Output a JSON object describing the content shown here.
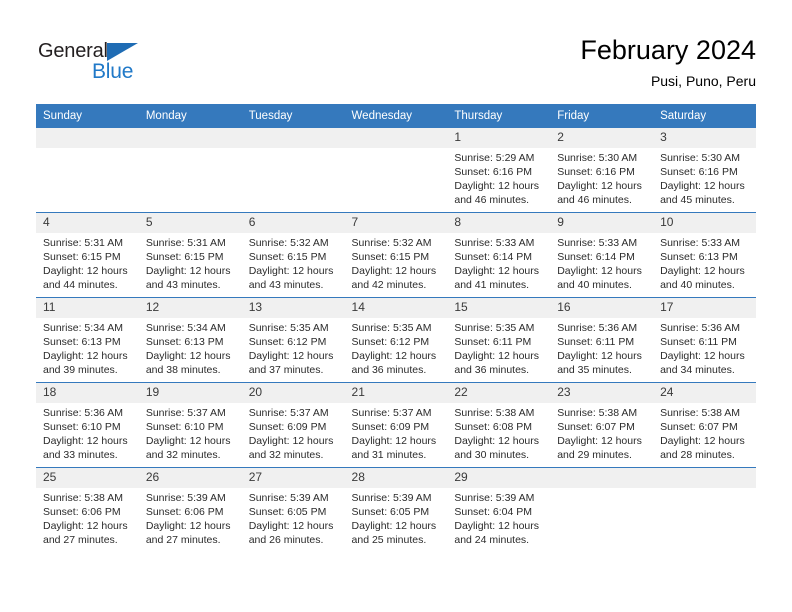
{
  "brand": {
    "name_dark": "General",
    "name_blue": "Blue",
    "accent_blue": "#2079c8",
    "triangle_blue": "#1f6cb4"
  },
  "header": {
    "title": "February 2024",
    "subtitle": "Pusi, Puno, Peru"
  },
  "calendar": {
    "header_bg": "#3579bd",
    "daynum_bg": "#f0f0f0",
    "weekdays": [
      "Sunday",
      "Monday",
      "Tuesday",
      "Wednesday",
      "Thursday",
      "Friday",
      "Saturday"
    ],
    "weeks": [
      [
        {
          "day": "",
          "sunrise": "",
          "sunset": "",
          "daylight": "",
          "blank": true
        },
        {
          "day": "",
          "sunrise": "",
          "sunset": "",
          "daylight": "",
          "blank": true
        },
        {
          "day": "",
          "sunrise": "",
          "sunset": "",
          "daylight": "",
          "blank": true
        },
        {
          "day": "",
          "sunrise": "",
          "sunset": "",
          "daylight": "",
          "blank": true
        },
        {
          "day": "1",
          "sunrise": "Sunrise: 5:29 AM",
          "sunset": "Sunset: 6:16 PM",
          "daylight": "Daylight: 12 hours and 46 minutes."
        },
        {
          "day": "2",
          "sunrise": "Sunrise: 5:30 AM",
          "sunset": "Sunset: 6:16 PM",
          "daylight": "Daylight: 12 hours and 46 minutes."
        },
        {
          "day": "3",
          "sunrise": "Sunrise: 5:30 AM",
          "sunset": "Sunset: 6:16 PM",
          "daylight": "Daylight: 12 hours and 45 minutes."
        }
      ],
      [
        {
          "day": "4",
          "sunrise": "Sunrise: 5:31 AM",
          "sunset": "Sunset: 6:15 PM",
          "daylight": "Daylight: 12 hours and 44 minutes."
        },
        {
          "day": "5",
          "sunrise": "Sunrise: 5:31 AM",
          "sunset": "Sunset: 6:15 PM",
          "daylight": "Daylight: 12 hours and 43 minutes."
        },
        {
          "day": "6",
          "sunrise": "Sunrise: 5:32 AM",
          "sunset": "Sunset: 6:15 PM",
          "daylight": "Daylight: 12 hours and 43 minutes."
        },
        {
          "day": "7",
          "sunrise": "Sunrise: 5:32 AM",
          "sunset": "Sunset: 6:15 PM",
          "daylight": "Daylight: 12 hours and 42 minutes."
        },
        {
          "day": "8",
          "sunrise": "Sunrise: 5:33 AM",
          "sunset": "Sunset: 6:14 PM",
          "daylight": "Daylight: 12 hours and 41 minutes."
        },
        {
          "day": "9",
          "sunrise": "Sunrise: 5:33 AM",
          "sunset": "Sunset: 6:14 PM",
          "daylight": "Daylight: 12 hours and 40 minutes."
        },
        {
          "day": "10",
          "sunrise": "Sunrise: 5:33 AM",
          "sunset": "Sunset: 6:13 PM",
          "daylight": "Daylight: 12 hours and 40 minutes."
        }
      ],
      [
        {
          "day": "11",
          "sunrise": "Sunrise: 5:34 AM",
          "sunset": "Sunset: 6:13 PM",
          "daylight": "Daylight: 12 hours and 39 minutes."
        },
        {
          "day": "12",
          "sunrise": "Sunrise: 5:34 AM",
          "sunset": "Sunset: 6:13 PM",
          "daylight": "Daylight: 12 hours and 38 minutes."
        },
        {
          "day": "13",
          "sunrise": "Sunrise: 5:35 AM",
          "sunset": "Sunset: 6:12 PM",
          "daylight": "Daylight: 12 hours and 37 minutes."
        },
        {
          "day": "14",
          "sunrise": "Sunrise: 5:35 AM",
          "sunset": "Sunset: 6:12 PM",
          "daylight": "Daylight: 12 hours and 36 minutes."
        },
        {
          "day": "15",
          "sunrise": "Sunrise: 5:35 AM",
          "sunset": "Sunset: 6:11 PM",
          "daylight": "Daylight: 12 hours and 36 minutes."
        },
        {
          "day": "16",
          "sunrise": "Sunrise: 5:36 AM",
          "sunset": "Sunset: 6:11 PM",
          "daylight": "Daylight: 12 hours and 35 minutes."
        },
        {
          "day": "17",
          "sunrise": "Sunrise: 5:36 AM",
          "sunset": "Sunset: 6:11 PM",
          "daylight": "Daylight: 12 hours and 34 minutes."
        }
      ],
      [
        {
          "day": "18",
          "sunrise": "Sunrise: 5:36 AM",
          "sunset": "Sunset: 6:10 PM",
          "daylight": "Daylight: 12 hours and 33 minutes."
        },
        {
          "day": "19",
          "sunrise": "Sunrise: 5:37 AM",
          "sunset": "Sunset: 6:10 PM",
          "daylight": "Daylight: 12 hours and 32 minutes."
        },
        {
          "day": "20",
          "sunrise": "Sunrise: 5:37 AM",
          "sunset": "Sunset: 6:09 PM",
          "daylight": "Daylight: 12 hours and 32 minutes."
        },
        {
          "day": "21",
          "sunrise": "Sunrise: 5:37 AM",
          "sunset": "Sunset: 6:09 PM",
          "daylight": "Daylight: 12 hours and 31 minutes."
        },
        {
          "day": "22",
          "sunrise": "Sunrise: 5:38 AM",
          "sunset": "Sunset: 6:08 PM",
          "daylight": "Daylight: 12 hours and 30 minutes."
        },
        {
          "day": "23",
          "sunrise": "Sunrise: 5:38 AM",
          "sunset": "Sunset: 6:07 PM",
          "daylight": "Daylight: 12 hours and 29 minutes."
        },
        {
          "day": "24",
          "sunrise": "Sunrise: 5:38 AM",
          "sunset": "Sunset: 6:07 PM",
          "daylight": "Daylight: 12 hours and 28 minutes."
        }
      ],
      [
        {
          "day": "25",
          "sunrise": "Sunrise: 5:38 AM",
          "sunset": "Sunset: 6:06 PM",
          "daylight": "Daylight: 12 hours and 27 minutes."
        },
        {
          "day": "26",
          "sunrise": "Sunrise: 5:39 AM",
          "sunset": "Sunset: 6:06 PM",
          "daylight": "Daylight: 12 hours and 27 minutes."
        },
        {
          "day": "27",
          "sunrise": "Sunrise: 5:39 AM",
          "sunset": "Sunset: 6:05 PM",
          "daylight": "Daylight: 12 hours and 26 minutes."
        },
        {
          "day": "28",
          "sunrise": "Sunrise: 5:39 AM",
          "sunset": "Sunset: 6:05 PM",
          "daylight": "Daylight: 12 hours and 25 minutes."
        },
        {
          "day": "29",
          "sunrise": "Sunrise: 5:39 AM",
          "sunset": "Sunset: 6:04 PM",
          "daylight": "Daylight: 12 hours and 24 minutes."
        },
        {
          "day": "",
          "sunrise": "",
          "sunset": "",
          "daylight": "",
          "blank": true
        },
        {
          "day": "",
          "sunrise": "",
          "sunset": "",
          "daylight": "",
          "blank": true
        }
      ]
    ]
  }
}
